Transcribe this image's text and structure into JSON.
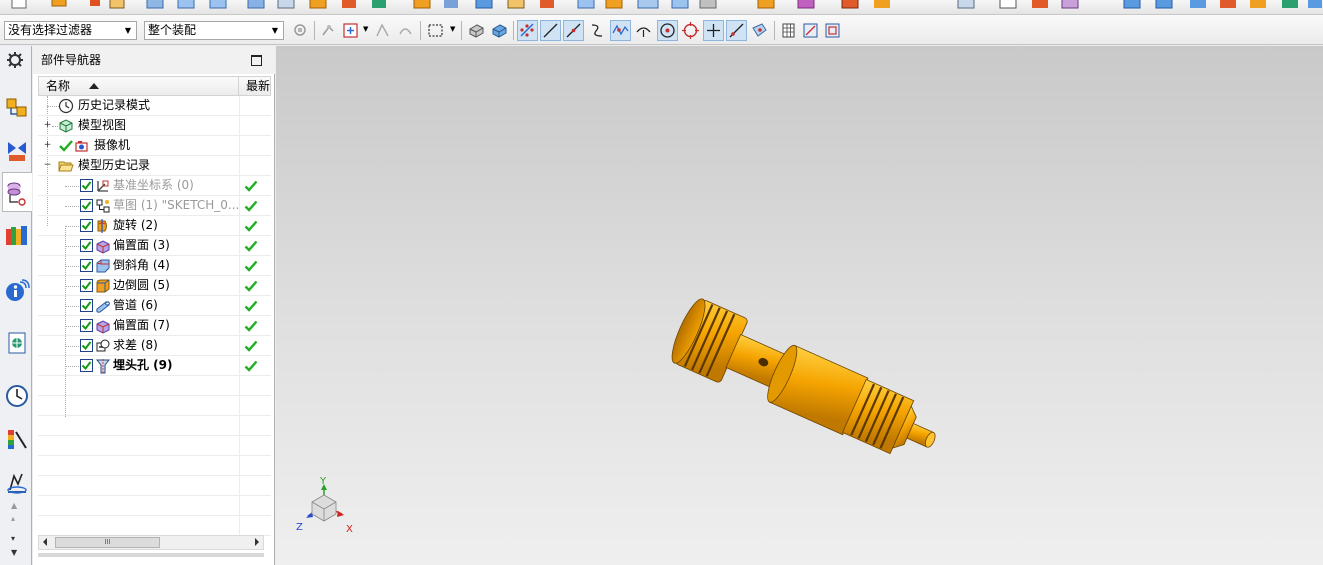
{
  "selection_bar": {
    "filter_value": "没有选择过滤器",
    "scope_value": "整个装配"
  },
  "navigator": {
    "title": "部件导航器",
    "col_name": "名称",
    "col_latest": "最新"
  },
  "tree": {
    "history_mode": "历史记录模式",
    "model_views": "模型视图",
    "cameras": "摄像机",
    "model_history": "模型历史记录",
    "features": [
      {
        "label": "基准坐标系 (0)",
        "dim": true
      },
      {
        "label": "草图 (1) \"SKETCH_0...",
        "dim": true
      },
      {
        "label": "旋转 (2)"
      },
      {
        "label": "偏置面 (3)"
      },
      {
        "label": "倒斜角 (4)"
      },
      {
        "label": "边倒圆 (5)"
      },
      {
        "label": "管道 (6)"
      },
      {
        "label": "偏置面 (7)"
      },
      {
        "label": "求差 (8)"
      },
      {
        "label": "埋头孔 (9)",
        "bold": true
      }
    ]
  },
  "scrollbar": {
    "thumb_glyph": "III"
  },
  "triad": {
    "x": "X",
    "y": "Y",
    "z": "Z"
  },
  "colors": {
    "part": "#f5a400",
    "check": "#1fae1f",
    "toolbar_active": "#cfe3f5"
  }
}
